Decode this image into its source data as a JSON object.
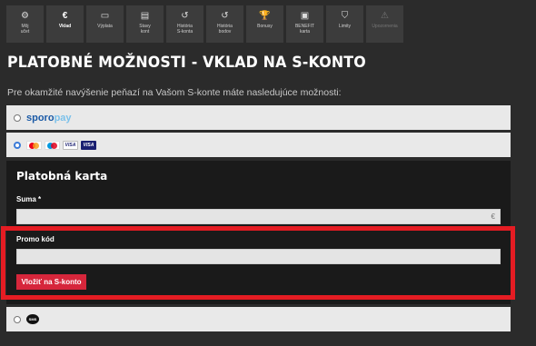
{
  "nav": {
    "items": [
      {
        "label": "Môj\nučet",
        "icon": "⚙"
      },
      {
        "label": "Vklad",
        "icon": "€"
      },
      {
        "label": "Výplata",
        "icon": "▭"
      },
      {
        "label": "Stavy\nkont",
        "icon": "▤"
      },
      {
        "label": "História\nS-konta",
        "icon": "↺"
      },
      {
        "label": "História\nbodov",
        "icon": "↺"
      },
      {
        "label": "Bonusy",
        "icon": "🏆"
      },
      {
        "label": "BENEFIT\nkarta",
        "icon": "▣"
      },
      {
        "label": "Limity",
        "icon": "⛉"
      },
      {
        "label": "Upozornenia",
        "icon": "⚠"
      }
    ]
  },
  "page_title": "PLATOBNÉ MOŽNOSTI - VKLAD NA S-KONTO",
  "intro": "Pre okamžité navýšenie peňazí na Vašom S-konte máte nasledujúce možnosti:",
  "options": {
    "sporopay": {
      "brand_a": "sporo",
      "brand_b": "pay"
    },
    "cards": {
      "visa1": "VISA",
      "visa2": "VISA"
    },
    "sms": {
      "label": "SMS"
    }
  },
  "panel": {
    "title": "Platobná karta",
    "amount_label": "Suma *",
    "amount_value": "",
    "currency": "€",
    "promo_label": "Promo kód",
    "promo_value": "",
    "submit_label": "Vložiť na S-konto"
  },
  "colors": {
    "accent": "#d6263b",
    "highlight": "#e51c23",
    "background": "#2b2b2b"
  }
}
